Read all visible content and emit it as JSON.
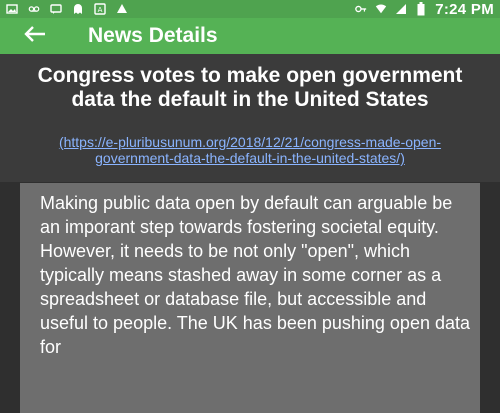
{
  "status_bar": {
    "time": "7:24 PM",
    "left_icons": [
      "image-icon",
      "voicemail-icon",
      "message-icon",
      "ghost-icon",
      "translate-icon",
      "upload-icon"
    ],
    "right_icons": [
      "key-icon",
      "wifi-icon",
      "signal-icon",
      "battery-icon"
    ]
  },
  "app_bar": {
    "title": "News Details",
    "back_icon": "arrow-left-icon"
  },
  "article": {
    "title": "Congress votes to make open government data the default in the United States",
    "url": "(https://e-pluribusunum.org/2018/12/21/congress-made-open-government-data-the-default-in-the-united-states/)",
    "body": "Making public data open by default can arguable be an imporant step towards fostering societal equity. However, it needs to be not only \"open\", which typically means stashed away in some corner as a spreadsheet or database file, but accessible and useful to people. The UK has been pushing open data for"
  },
  "colors": {
    "status_bar": "#4fa34f",
    "app_bar": "#55b255",
    "header_bg": "#3b3b3b",
    "card_bg": "#6e6e6e",
    "link": "#8ab4ff"
  }
}
